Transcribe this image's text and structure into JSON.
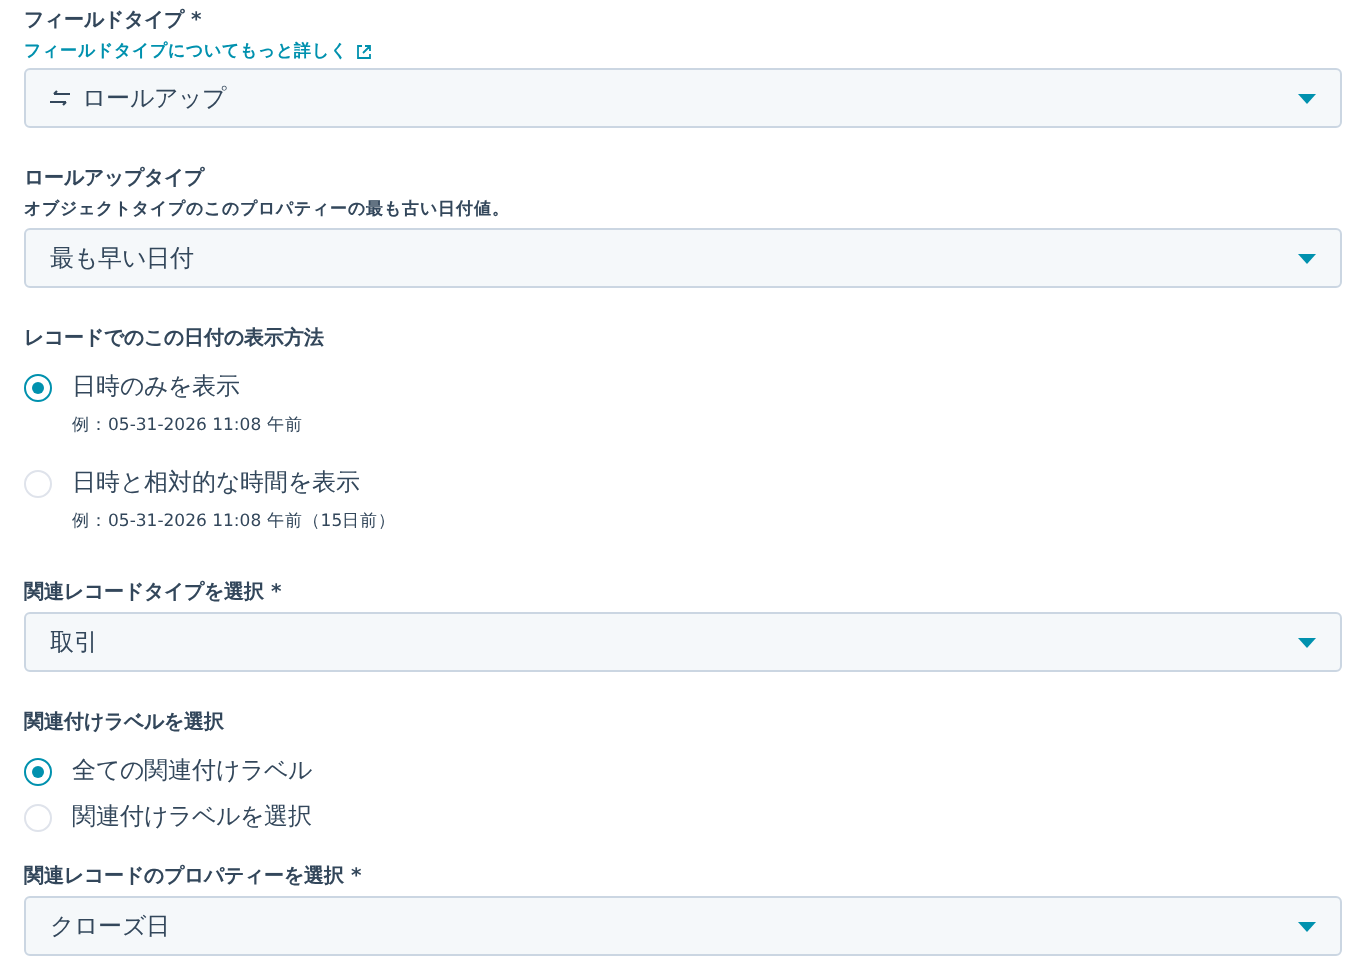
{
  "sections": [
    {
      "kind": "select",
      "label": "フィールドタイプ *",
      "link": "フィールドタイプについてもっと詳しく",
      "value": "ロールアップ",
      "value_icon": true
    },
    {
      "kind": "select",
      "label": "ロールアップタイプ",
      "help": "オブジェクトタイプのこのプロパティーの最も古い日付値。",
      "value": "最も早い日付"
    },
    {
      "kind": "radio",
      "label": "レコードでのこの日付の表示方法",
      "options": [
        {
          "label": "日時のみを表示",
          "example": "例：05-31-2026 11:08 午前",
          "selected": true
        },
        {
          "label": "日時と相対的な時間を表示",
          "example": "例：05-31-2026 11:08 午前（15日前）",
          "selected": false
        }
      ]
    },
    {
      "kind": "select",
      "label": "関連レコードタイプを選択 *",
      "value": "取引"
    },
    {
      "kind": "radio",
      "label": "関連付けラベルを選択",
      "options": [
        {
          "label": "全ての関連付けラベル",
          "selected": true
        },
        {
          "label": "関連付けラベルを選択",
          "selected": false
        }
      ]
    },
    {
      "kind": "select",
      "label": "関連レコードのプロパティーを選択 *",
      "value": "クローズ日"
    }
  ]
}
